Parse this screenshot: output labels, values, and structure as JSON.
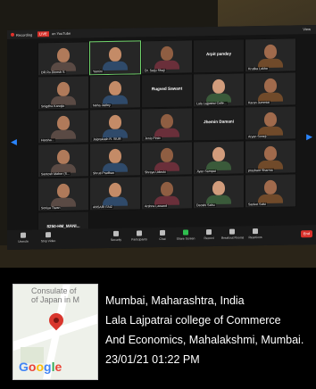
{
  "meeting": {
    "recording_label": "Recording",
    "live_badge": "LIVE",
    "live_on": "on YouTube",
    "view_label": "View",
    "participants": [
      {
        "name": "DR.Ru.Dinesh S.",
        "kind": "video"
      },
      {
        "name": "Yamini",
        "kind": "video",
        "active": true
      },
      {
        "name": "Dr. Saiju Shaji",
        "kind": "video"
      },
      {
        "name": "Arpit pandey",
        "kind": "blank"
      },
      {
        "name": "Krutika Lakhe",
        "kind": "video"
      },
      {
        "name": "Snigdha Kanojia",
        "kind": "video"
      },
      {
        "name": "Neha Jaitley",
        "kind": "video"
      },
      {
        "name": "Rugved Sawant",
        "kind": "blank"
      },
      {
        "name": "Lala Lajpatrai Colle...",
        "kind": "video"
      },
      {
        "name": "Karan Jummiai",
        "kind": "video"
      },
      {
        "name": "Harsha...",
        "kind": "video"
      },
      {
        "name": "Jaiprakash R. SIUR",
        "kind": "video"
      },
      {
        "name": "Jenis Pinto",
        "kind": "video"
      },
      {
        "name": "Jhemin Damani",
        "kind": "blank"
      },
      {
        "name": "Aryan Soneji",
        "kind": "video"
      },
      {
        "name": "Santosh Maher (S...",
        "kind": "video"
      },
      {
        "name": "Shruti Pradhan",
        "kind": "video"
      },
      {
        "name": "Shreya Udeshi",
        "kind": "video"
      },
      {
        "name": "Jiyan Sampat",
        "kind": "video"
      },
      {
        "name": "prashant Sharma",
        "kind": "video"
      },
      {
        "name": "Soniya Tiwari",
        "kind": "video"
      },
      {
        "name": "ANSARI FAIZ",
        "kind": "video"
      },
      {
        "name": "Arshna Lawand",
        "kind": "video"
      },
      {
        "name": "Deoshi Sahu",
        "kind": "video"
      },
      {
        "name": "Sanket Salvi",
        "kind": "video"
      },
      {
        "name": "8250-HM_MANI...",
        "kind": "blank"
      }
    ],
    "toolbar": {
      "unmute": "Unmute",
      "stop_video": "Stop Video",
      "security": "Security",
      "participants": "Participants",
      "participants_count": "26",
      "chat": "Chat",
      "share_screen": "Share Screen",
      "record": "Record",
      "breakout": "Breakout Rooms",
      "reactions": "Reactions",
      "end": "End"
    }
  },
  "geotag": {
    "map_label_line1": "Consulate of",
    "map_label_line2": "of Japan in M",
    "map_brand": "Google",
    "line1": "Mumbai, Maharashtra, India",
    "line2": "Lala Lajpatrai college of Commerce",
    "line3": "And Economics, Mahalakshmi, Mumbai.",
    "line4": "23/01/21 01:22 PM"
  },
  "colors": {
    "live_red": "#d9312b",
    "active_speaker": "#6fd16a",
    "pin_red": "#d9362d"
  }
}
